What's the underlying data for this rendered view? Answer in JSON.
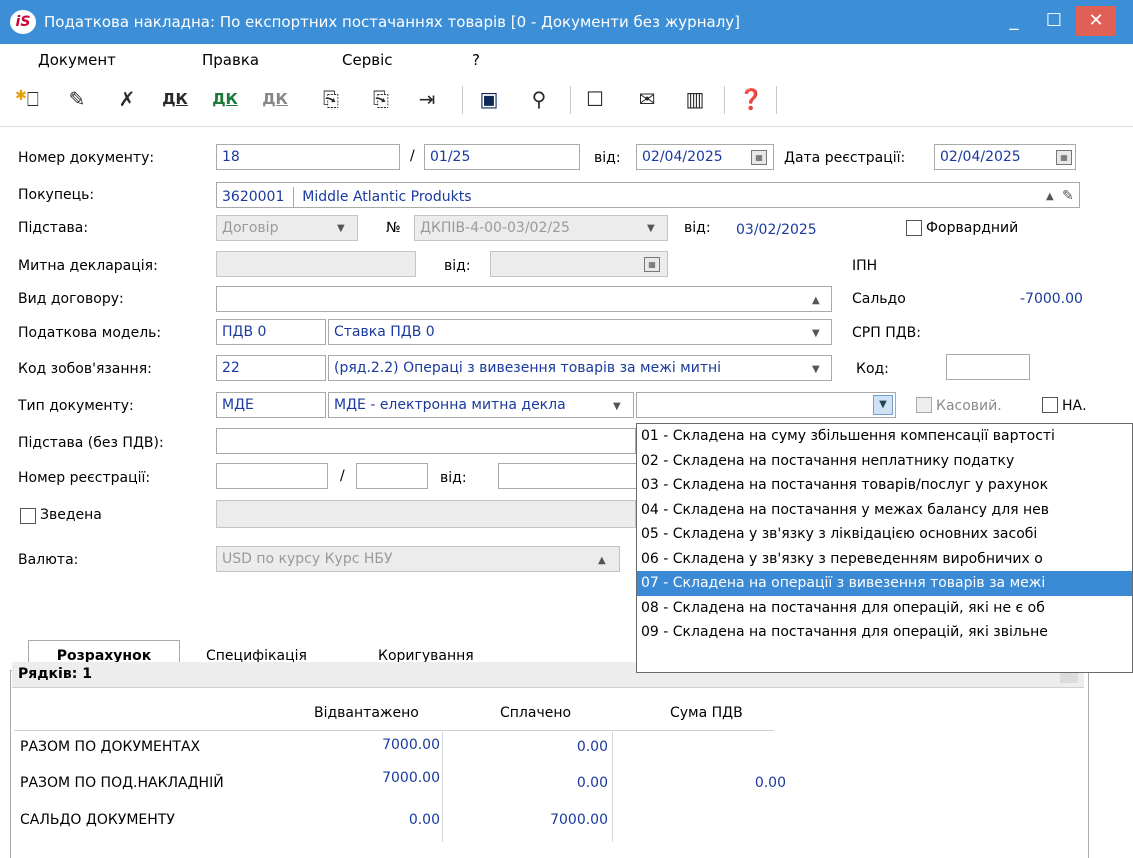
{
  "window": {
    "title": "Податкова накладна: По експортних  постачаннях товарів [0 - Документи без журналу]",
    "logo_text": "iS"
  },
  "menu": [
    "Документ",
    "Правка",
    "Сервіс",
    "?"
  ],
  "toolbar": {
    "icons": [
      "new-doc-icon",
      "edit-doc-icon",
      "delete-doc-icon",
      "debit-credit-icon",
      "debit-credit-green-icon",
      "debit-credit-gray-icon",
      "copy-doc-icon",
      "copy-doc-2-icon",
      "exit-doc-icon",
      "save-icon",
      "tree-icon",
      "form-icon",
      "mail-icon",
      "library-icon",
      "help-icon"
    ],
    "glyph_dk": "ДК"
  },
  "form": {
    "doc_number_label": "Номер документу:",
    "doc_number": "18",
    "doc_suffix": "01/25",
    "slash": "/",
    "from_label": "від:",
    "doc_date": "02/04/2025",
    "reg_date_label": "Дата реєстрації:",
    "reg_date": "02/04/2025",
    "buyer_label": "Покупець:",
    "buyer_code": "3620001",
    "buyer_name": "Middle Atlantic Produkts",
    "basis_label": "Підстава:",
    "basis_value": "Договір",
    "no_label": "№",
    "contract_no": "ДКПІВ-4-00-03/02/25",
    "contract_from_label": "від:",
    "contract_date": "03/02/2025",
    "forward_label": "Форвардний",
    "customs_label": "Митна декларація:",
    "customs_from_label": "від:",
    "ipn_label": "ІПН",
    "contract_type_label": "Вид договору:",
    "saldo_label": "Сальдо",
    "saldo_value": "-7000.00",
    "tax_model_label": "Податкова модель:",
    "tax_model_code": "ПДВ 0",
    "tax_model_name": "Ставка ПДВ 0",
    "srp_label": "СРП ПДВ:",
    "obligation_label": "Код зобов'язання:",
    "obligation_code": "22",
    "obligation_name": "(ряд.2.2) Операці з вивезення товарів за межі митні",
    "code_label": "Код:",
    "doc_type_label": "Тип документу:",
    "doc_type_code": "МДЕ",
    "doc_type_name": "МДЕ - електронна митна декла",
    "cash_label": "Касовий.",
    "na_label": "НА.",
    "basis_no_vat_label": "Підстава (без ПДВ):",
    "reg_number_label": "Номер реєстрації:",
    "reg_from_label": "від:",
    "consolidated_label": "Зведена",
    "currency_label": "Валюта:",
    "currency_value": "USD по курсу Курс НБУ"
  },
  "dropdown": {
    "items": [
      "01 - Складена на суму збільшення компенсації вартості",
      "02 - Складена на постачання неплатнику податку",
      "03 - Складена на постачання товарів/послуг у рахунок",
      "04 - Складена на постачання у межах балансу для нев",
      "05 - Складена у зв'язку з ліквідацією основних засобі",
      "06 - Складена у зв'язку з переведенням виробничих о",
      "07 - Складена на операції з вивезення товарів за межі",
      "08 - Складена на постачання для операцій, які не є об",
      "09 - Складена на постачання для операцій, які звільне"
    ],
    "selected_index": 6
  },
  "tabs": [
    "Розрахунок",
    "Специфікація",
    "Коригування"
  ],
  "summary": {
    "rows_label": "Рядків: 1",
    "headers": [
      "Відвантажено",
      "Сплачено",
      "Сума ПДВ"
    ],
    "rows": [
      {
        "label": "РАЗОМ ПО ДОКУМЕНТАХ",
        "shipped": "7000.00",
        "paid": "0.00",
        "vat": ""
      },
      {
        "label": "РАЗОМ ПО ПОД.НАКЛАДНІЙ",
        "shipped": "7000.00",
        "paid": "0.00",
        "vat": "0.00"
      },
      {
        "label": "САЛЬДО ДОКУМЕНТУ",
        "shipped": "0.00",
        "paid": "7000.00",
        "vat": ""
      }
    ]
  }
}
